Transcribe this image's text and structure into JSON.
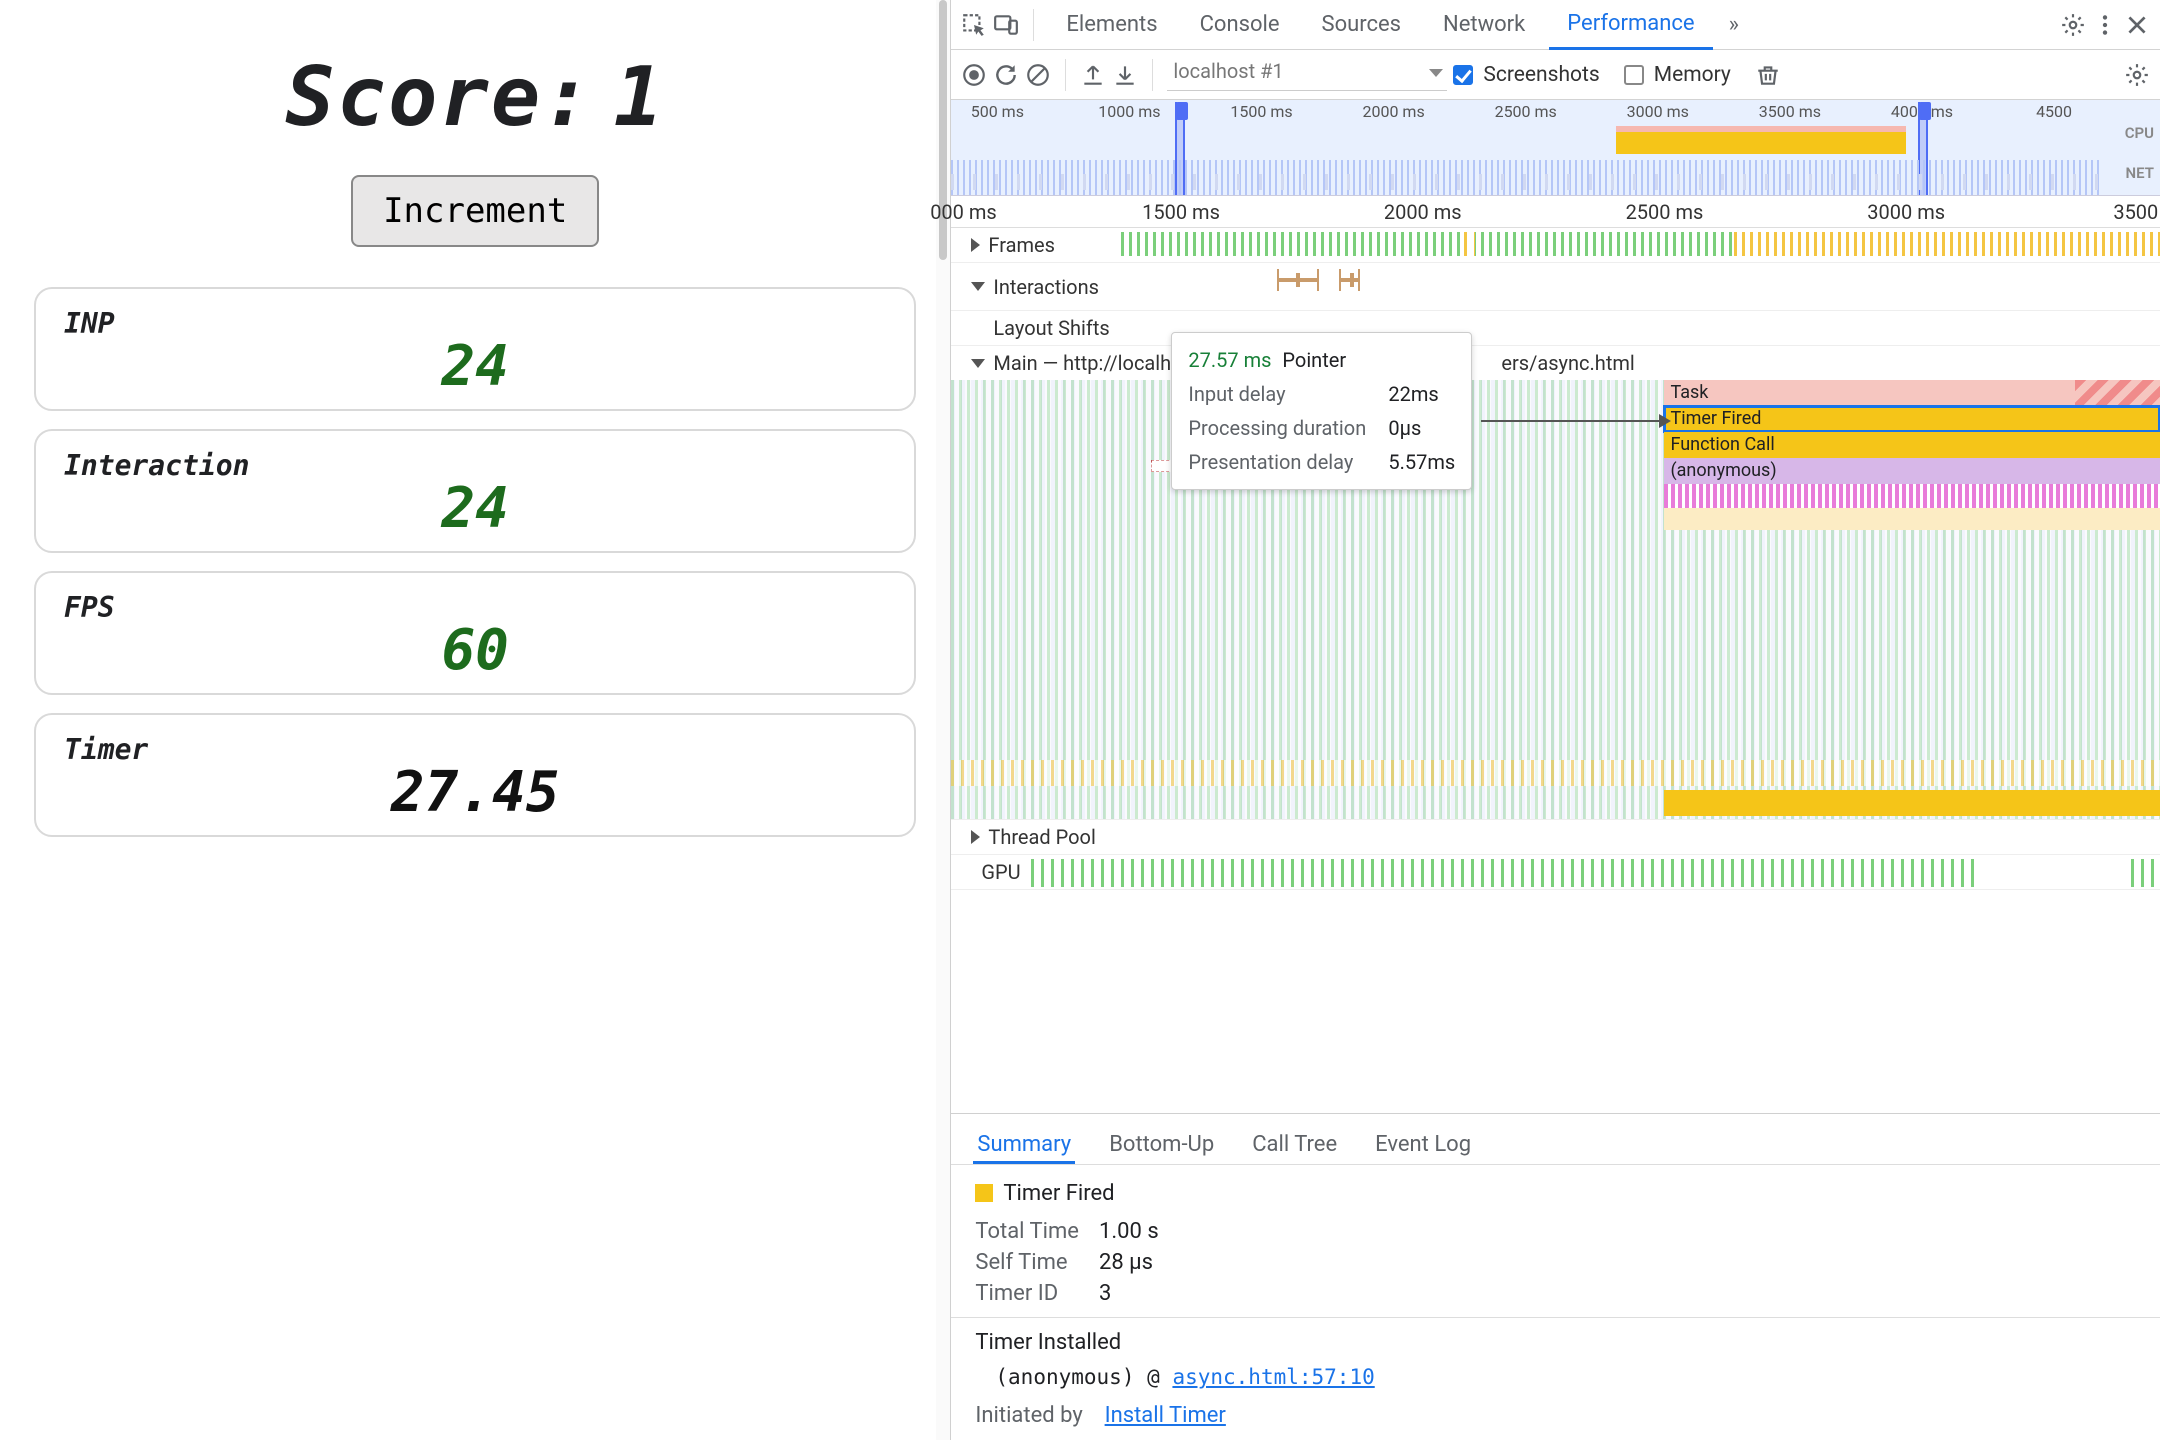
{
  "page": {
    "score_label": "Score:",
    "score_value": "1",
    "increment_label": "Increment",
    "metrics": {
      "inp": {
        "label": "INP",
        "value": "24"
      },
      "interaction": {
        "label": "Interaction",
        "value": "24"
      },
      "fps": {
        "label": "FPS",
        "value": "60"
      },
      "timer": {
        "label": "Timer",
        "value": "27.45"
      }
    }
  },
  "devtools": {
    "tabs": {
      "elements": "Elements",
      "console": "Console",
      "sources": "Sources",
      "network": "Network",
      "performance": "Performance"
    },
    "toolbar": {
      "recording_name": "localhost #1",
      "screenshots_label": "Screenshots",
      "memory_label": "Memory",
      "screenshots_checked": true,
      "memory_checked": false
    },
    "overview": {
      "cpu_label": "CPU",
      "net_label": "NET",
      "ticks": [
        "500 ms",
        "1000 ms",
        "1500 ms",
        "2000 ms",
        "2500 ms",
        "3000 ms",
        "3500 ms",
        "4000 ms",
        "4500"
      ]
    },
    "ruler": [
      "000 ms",
      "1500 ms",
      "2000 ms",
      "2500 ms",
      "3000 ms",
      "3500"
    ],
    "tracks": {
      "frames": "Frames",
      "interactions": "Interactions",
      "layout_shifts": "Layout Shifts",
      "main": "Main — http://localho",
      "main_suffix": "ers/async.html",
      "thread_pool": "Thread Pool",
      "gpu": "GPU"
    },
    "tooltip": {
      "time": "27.57 ms",
      "event": "Pointer",
      "rows": {
        "input_delay": {
          "k": "Input delay",
          "v": "22ms"
        },
        "processing_duration": {
          "k": "Processing duration",
          "v": "0µs"
        },
        "presentation_delay": {
          "k": "Presentation delay",
          "v": "5.57ms"
        }
      }
    },
    "flame": {
      "task": "Task",
      "timer_fired": "Timer Fired",
      "function_call": "Function Call",
      "anonymous": "(anonymous)"
    },
    "bottom_tabs": {
      "summary": "Summary",
      "bottom_up": "Bottom-Up",
      "call_tree": "Call Tree",
      "event_log": "Event Log"
    },
    "summary": {
      "title": "Timer Fired",
      "total_time_k": "Total Time",
      "total_time_v": "1.00 s",
      "self_time_k": "Self Time",
      "self_time_v": "28 µs",
      "timer_id_k": "Timer ID",
      "timer_id_v": "3"
    },
    "initiator": {
      "heading": "Timer Installed",
      "anon": "(anonymous)",
      "at": "@",
      "src": "async.html:57:10",
      "initiated_by_k": "Initiated by",
      "initiated_by_v": "Install Timer"
    }
  }
}
